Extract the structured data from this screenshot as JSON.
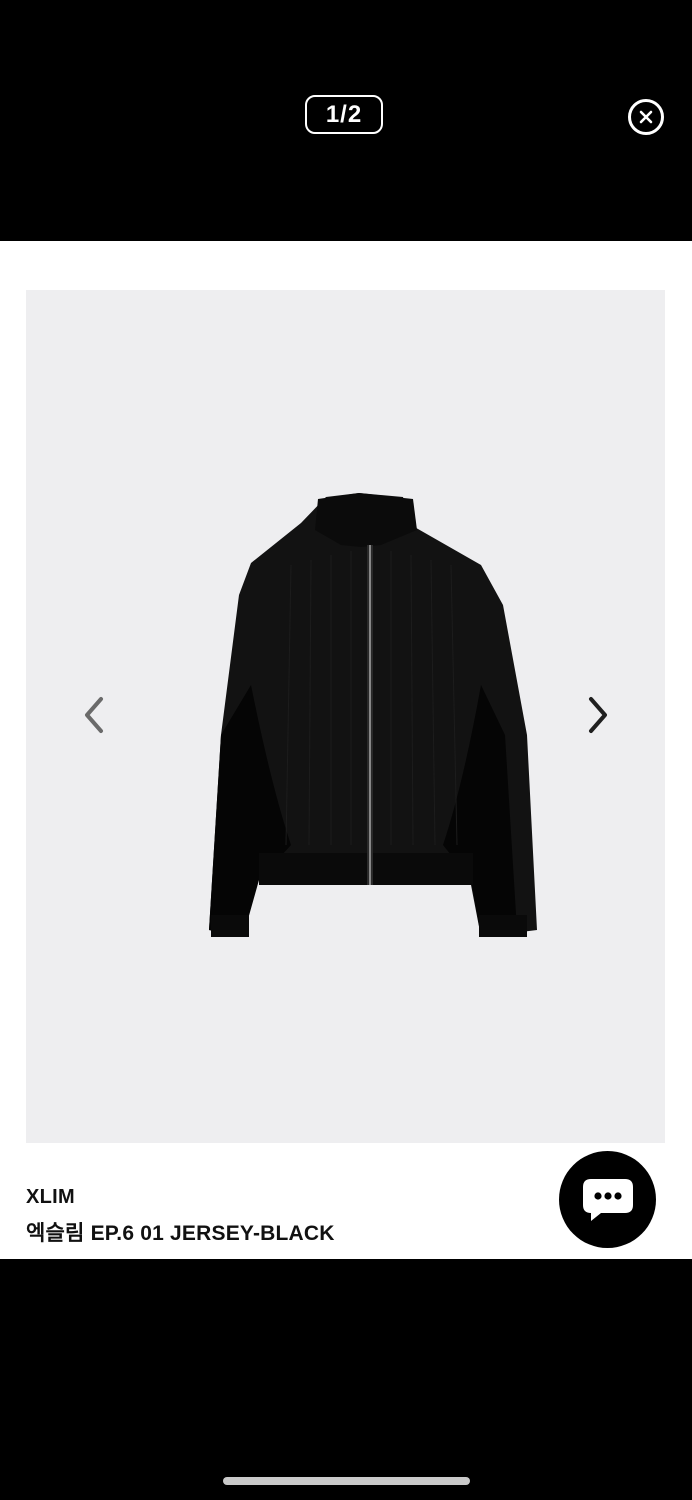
{
  "viewer": {
    "counter": "1/2"
  },
  "product": {
    "brand": "XLIM",
    "name": "엑슬림 EP.6 01 JERSEY-BLACK"
  },
  "icons": {
    "close": "close-circle-icon",
    "prev": "chevron-left-icon",
    "next": "chevron-right-icon",
    "chat": "chat-bubble-icon"
  },
  "colors": {
    "background": "#000000",
    "image_bg": "#eeeef0",
    "text": "#111111"
  }
}
